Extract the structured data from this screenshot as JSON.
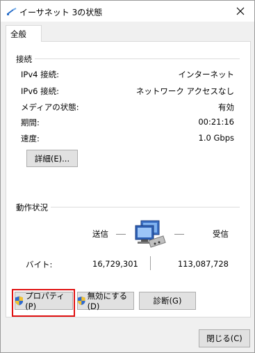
{
  "window": {
    "title": "イーサネット 3の状態"
  },
  "tabs": [
    {
      "label": "全般"
    }
  ],
  "connection": {
    "group_title": "接続",
    "rows": [
      {
        "label": "IPv4 接続:",
        "value": "インターネット"
      },
      {
        "label": "IPv6 接続:",
        "value": "ネットワーク アクセスなし"
      },
      {
        "label": "メディアの状態:",
        "value": "有効"
      },
      {
        "label": "期間:",
        "value": "00:21:16"
      },
      {
        "label": "速度:",
        "value": "1.0 Gbps"
      }
    ],
    "details_button": "詳細(E)..."
  },
  "activity": {
    "group_title": "動作状況",
    "sent_label": "送信",
    "received_label": "受信",
    "bytes_label": "バイト:",
    "bytes_sent": "16,729,301",
    "bytes_received": "113,087,728"
  },
  "buttons": {
    "properties": "プロパティ(P)",
    "disable": "無効にする(D)",
    "diagnose": "診断(G)",
    "close": "閉じる(C)"
  },
  "icons": {
    "title": "network-connection-icon",
    "close": "close-icon",
    "shield": "uac-shield-icon",
    "network": "network-computers-icon"
  },
  "colors": {
    "highlight": "#e01010",
    "window_bg": "#f0f0f0",
    "button_bg": "#e1e1e1"
  }
}
